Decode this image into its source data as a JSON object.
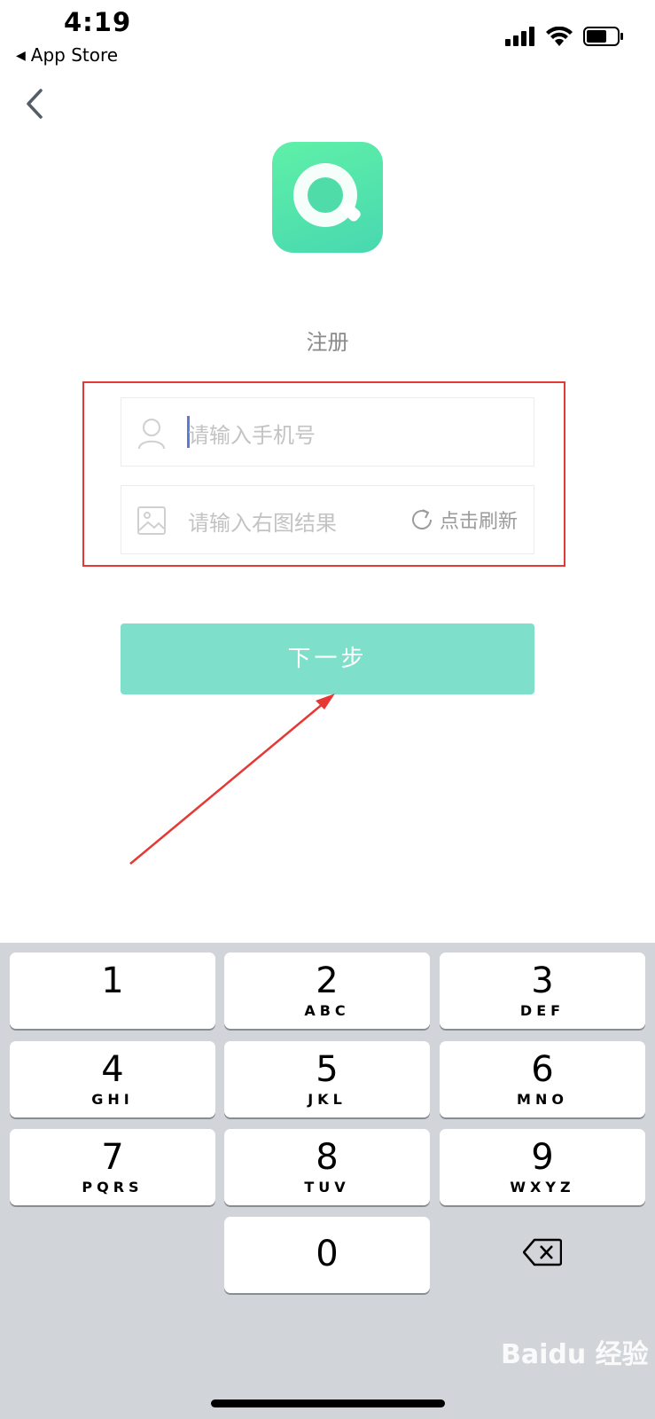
{
  "status_bar": {
    "time": "4:19",
    "back_app": "App Store"
  },
  "page": {
    "title": "注册"
  },
  "form": {
    "phone_placeholder": "请输入手机号",
    "captcha_placeholder": "请输入右图结果",
    "refresh_label": "点击刷新",
    "next_label": "下一步"
  },
  "keyboard": {
    "keys": [
      {
        "num": "1",
        "letters": ""
      },
      {
        "num": "2",
        "letters": "ABC"
      },
      {
        "num": "3",
        "letters": "DEF"
      },
      {
        "num": "4",
        "letters": "GHI"
      },
      {
        "num": "5",
        "letters": "JKL"
      },
      {
        "num": "6",
        "letters": "MNO"
      },
      {
        "num": "7",
        "letters": "PQRS"
      },
      {
        "num": "8",
        "letters": "TUV"
      },
      {
        "num": "9",
        "letters": "WXYZ"
      },
      {
        "num": "0",
        "letters": ""
      }
    ]
  },
  "watermark": "Baidu 经验",
  "colors": {
    "accent": "#7ee0cb",
    "annotation": "#e53935",
    "logo": "#4fdfae"
  },
  "icons": [
    "back-triangle-icon",
    "signal-icon",
    "wifi-icon",
    "battery-icon",
    "chevron-left-icon",
    "app-logo-icon",
    "user-icon",
    "image-icon",
    "refresh-icon",
    "backspace-icon"
  ]
}
